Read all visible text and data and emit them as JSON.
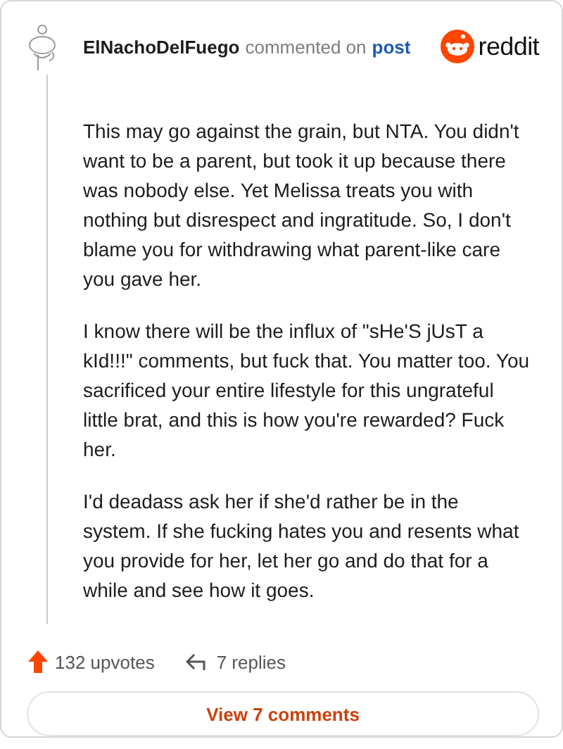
{
  "comment": {
    "author": "ElNachoDelFuego",
    "action": "commented on",
    "link": "post",
    "brand": "reddit",
    "paragraphs": [
      "This may go against the grain, but NTA. You didn't want to be a parent, but took it up because there was nobody else. Yet Melissa treats you with nothing but disrespect and ingratitude. So, I don't blame you for withdrawing what parent-like care you gave her.",
      "I know there will be the influx of \"sHe'S jUsT a kId!!!\" comments, but fuck that. You matter too. You sacrificed your entire lifestyle for this ungrateful little brat, and this is how you're rewarded? Fuck her.",
      "I'd deadass ask her if she'd rather be in the system. If she fucking hates you and resents what you provide for her, let her go and do that for a while and see how it goes."
    ],
    "upvotes": "132 upvotes",
    "replies": "7 replies",
    "button": "View 7 comments"
  }
}
